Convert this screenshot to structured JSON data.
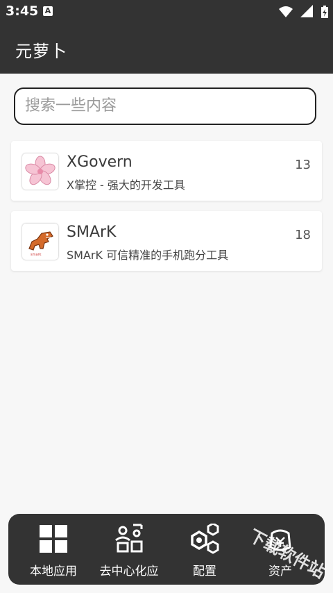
{
  "status_bar": {
    "time": "3:45",
    "notification_icon_letter": "A"
  },
  "app_bar": {
    "title": "元萝卜"
  },
  "search": {
    "placeholder": "搜索一些内容",
    "value": ""
  },
  "apps": [
    {
      "title": "XGovern",
      "description": "X掌控 - 强大的开发工具",
      "count": "13",
      "icon": "sakura-icon"
    },
    {
      "title": "SMArK",
      "description": "SMArK 可信精准的手机跑分工具",
      "count": "18",
      "icon": "dinosaur-icon"
    }
  ],
  "bottom_nav": {
    "items": [
      {
        "label": "本地应用",
        "icon": "grid-icon"
      },
      {
        "label": "去中心化应",
        "icon": "decentralized-icon"
      },
      {
        "label": "配置",
        "icon": "hexagon-nodes-icon"
      },
      {
        "label": "资产",
        "icon": "asset-icon"
      }
    ]
  },
  "watermark": "下载软件站",
  "colors": {
    "bar": "#333333",
    "background": "#f7f7f7",
    "card": "#ffffff"
  }
}
